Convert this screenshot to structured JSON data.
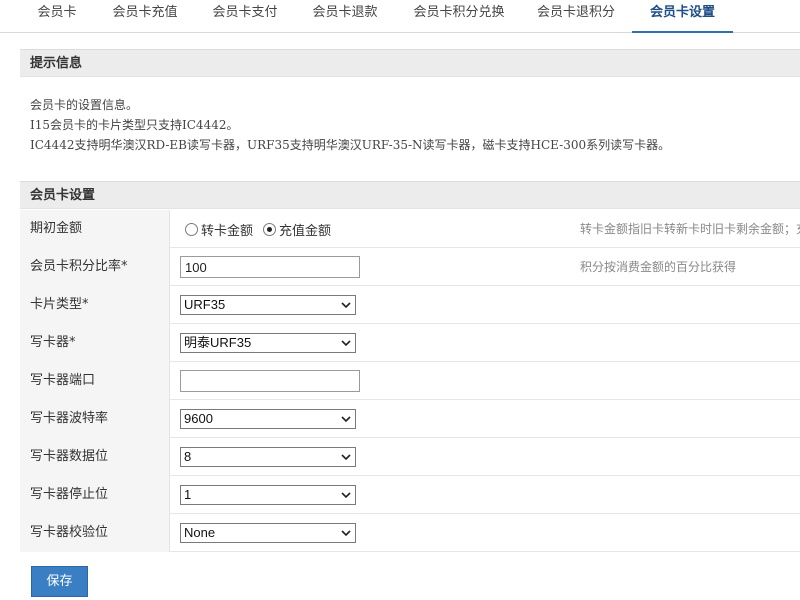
{
  "tabs": [
    {
      "label": "会员卡"
    },
    {
      "label": "会员卡充值"
    },
    {
      "label": "会员卡支付"
    },
    {
      "label": "会员卡退款"
    },
    {
      "label": "会员卡积分兑换"
    },
    {
      "label": "会员卡退积分"
    },
    {
      "label": "会员卡设置",
      "active": true
    }
  ],
  "notice": {
    "title": "提示信息",
    "lines": [
      "会员卡的设置信息。",
      "I15会员卡的卡片类型只支持IC4442。",
      "IC4442支持明华澳汉RD-EB读写卡器，URF35支持明华澳汉URF-35-N读写卡器，磁卡支持HCE-300系列读写卡器。"
    ]
  },
  "settings": {
    "title": "会员卡设置",
    "initial_amount": {
      "label": "期初金额",
      "options": [
        "转卡金额",
        "充值金额"
      ],
      "selected": "充值金额",
      "hint": "转卡金额指旧卡转新卡时旧卡剩余金额；充"
    },
    "points_ratio": {
      "label": "会员卡积分比率*",
      "value": "100",
      "hint": "积分按消费金额的百分比获得"
    },
    "card_type": {
      "label": "卡片类型*",
      "value": "URF35"
    },
    "writer": {
      "label": "写卡器*",
      "value": "明泰URF35"
    },
    "writer_port": {
      "label": "写卡器端口",
      "value": ""
    },
    "baud_rate": {
      "label": "写卡器波特率",
      "value": "9600"
    },
    "data_bits": {
      "label": "写卡器数据位",
      "value": "8"
    },
    "stop_bits": {
      "label": "写卡器停止位",
      "value": "1"
    },
    "parity": {
      "label": "写卡器校验位",
      "value": "None"
    }
  },
  "save_label": "保存"
}
